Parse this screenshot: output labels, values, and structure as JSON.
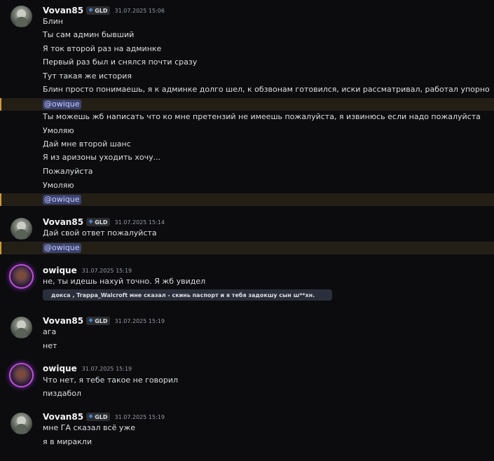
{
  "messages": [
    {
      "author": "Vovan85",
      "tag": "GLD",
      "time": "31.07.2025 15:06",
      "lines": [
        "Блин",
        "Ты сам админ бывший",
        "Я ток второй раз на админке",
        "Первый раз был и снялся почти сразу",
        "Тут такая же история",
        "Блин просто понимаешь, я к админке долго шел, к обзвонам готовился, иски рассматривал, работал упорно",
        "@owique",
        "Ты можешь жб написать что ко мне претензий не имеешь пожалуйста, я извинюсь если надо пожалуйста",
        "Умоляю",
        "Дай мне второй шанс",
        "Я из аризоны уходить хочу...",
        "Пожалуйста",
        "Умоляю",
        "@owique"
      ]
    },
    {
      "author": "Vovan85",
      "tag": "GLD",
      "time": "31.07.2025 15:14",
      "lines": [
        "Дай свой ответ пожалуйста",
        "@owique"
      ]
    },
    {
      "author": "owique",
      "time": "31.07.2025 15:19",
      "lines": [
        "не, ты идешь нахуй точно. Я жб увидел"
      ],
      "quote": "докса , Trappa_Walcroft мне сказал - скинь паспорт и я тебя задокшу сын ш**хн."
    },
    {
      "author": "Vovan85",
      "tag": "GLD",
      "time": "31.07.2025 15:19",
      "lines": [
        "ага",
        "нет"
      ]
    },
    {
      "author": "owique",
      "time": "31.07.2025 15:19",
      "lines": [
        "Что нет, я тебе такое не говорил",
        "пиздабол"
      ]
    },
    {
      "author": "Vovan85",
      "tag": "GLD",
      "time": "31.07.2025 15:19",
      "lines": [
        "мне ГА сказал всё уже",
        "я в миракли"
      ]
    }
  ],
  "colors": {
    "background": "#0c0c0f",
    "mention_highlight": "#231f15",
    "mention_bar": "#d09a33",
    "mention_pill": "#3c4270",
    "tag_icon": "#4ea3ff",
    "avatar_ring": "#c24fe0"
  },
  "icons": {
    "guild_tag": "guild-tag-icon"
  }
}
